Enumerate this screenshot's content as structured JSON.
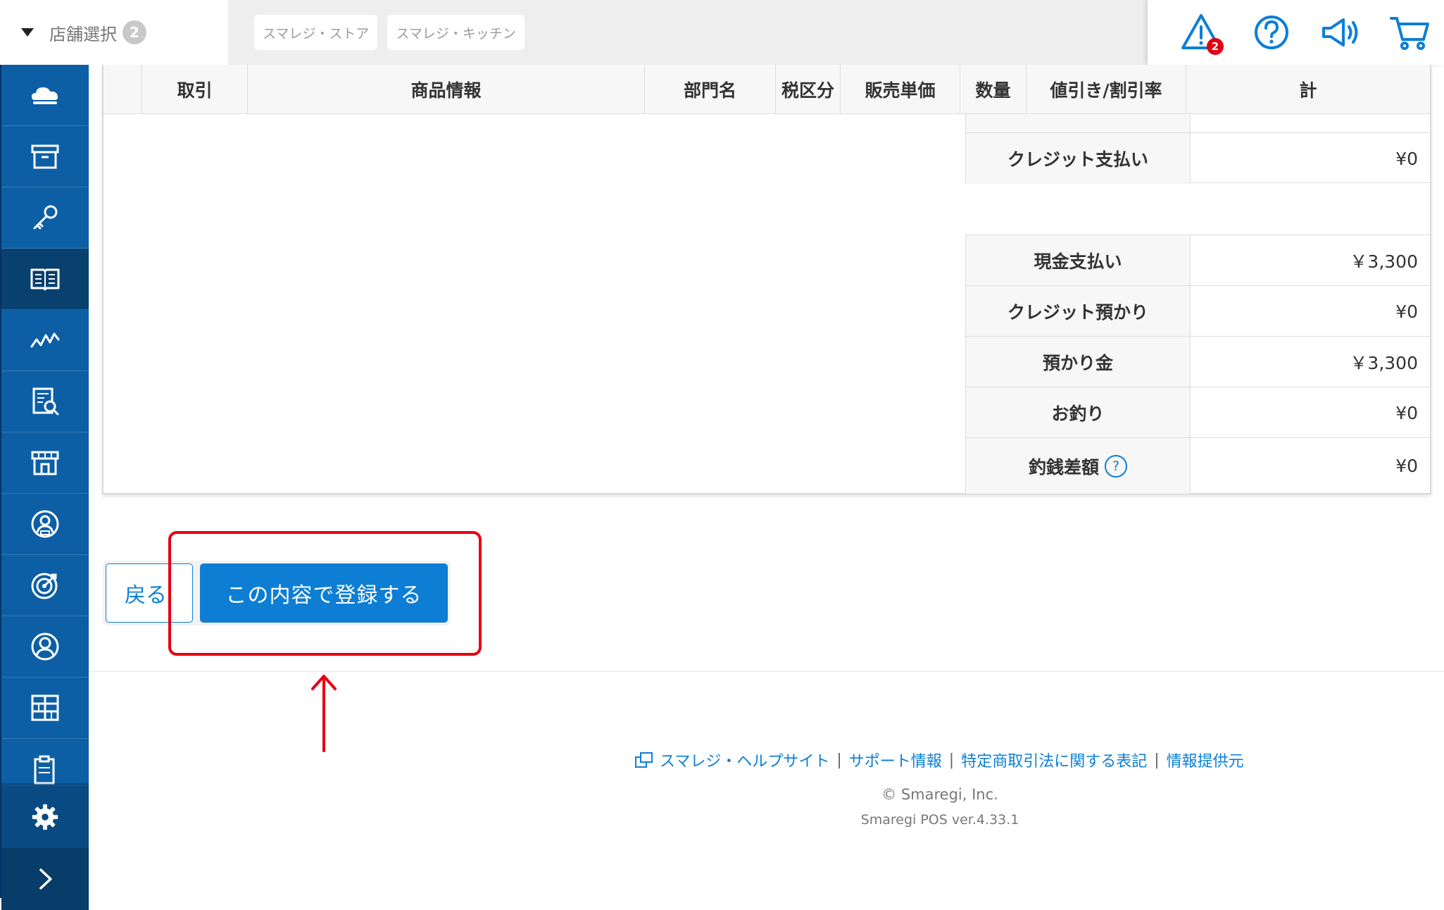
{
  "header": {
    "store_select_label": "店舗選択",
    "store_count": "2",
    "store_chips": [
      "スマレジ・ストア",
      "スマレジ・キッチン"
    ],
    "alert_count": "2",
    "icons": [
      "warning-icon",
      "help-icon",
      "announcement-icon",
      "cart-icon"
    ]
  },
  "sidebar": {
    "items": [
      "cloud-icon",
      "archive-icon",
      "key-icon",
      "book-icon",
      "chart-icon",
      "report-icon",
      "store-icon",
      "member-icon",
      "target-icon",
      "user-icon",
      "grid-icon",
      "clipboard-icon"
    ],
    "active_index": 3,
    "bottom": [
      "gear-icon",
      "chevron-right-icon"
    ]
  },
  "table": {
    "headers": [
      "取引",
      "商品情報",
      "部門名",
      "税区分",
      "販売単価",
      "数量",
      "値引き/割引率",
      "計"
    ],
    "top_rows": [
      {
        "label": "クレジット支払い",
        "value": "¥0"
      }
    ],
    "rows": [
      {
        "label": "現金支払い",
        "value": "￥3,300"
      },
      {
        "label": "クレジット預かり",
        "value": "¥0"
      },
      {
        "label": "預かり金",
        "value": "￥3,300"
      },
      {
        "label": "お釣り",
        "value": "¥0"
      },
      {
        "label": "釣銭差額",
        "value": "¥0",
        "help": "?"
      }
    ]
  },
  "actions": {
    "back_label": "戻る",
    "submit_label": "この内容で登録する"
  },
  "footer": {
    "links": [
      "スマレジ・ヘルプサイト",
      "サポート情報",
      "特定商取引法に関する表記",
      "情報提供元"
    ],
    "separator": "|",
    "copyright": "© Smaregi, Inc.",
    "version": "Smaregi POS ver.4.33.1"
  },
  "colors": {
    "accent": "#0d7ed4",
    "sidebar": "#0c5fa5",
    "sidebar_active": "#08406f",
    "annotation": "#e60012"
  }
}
